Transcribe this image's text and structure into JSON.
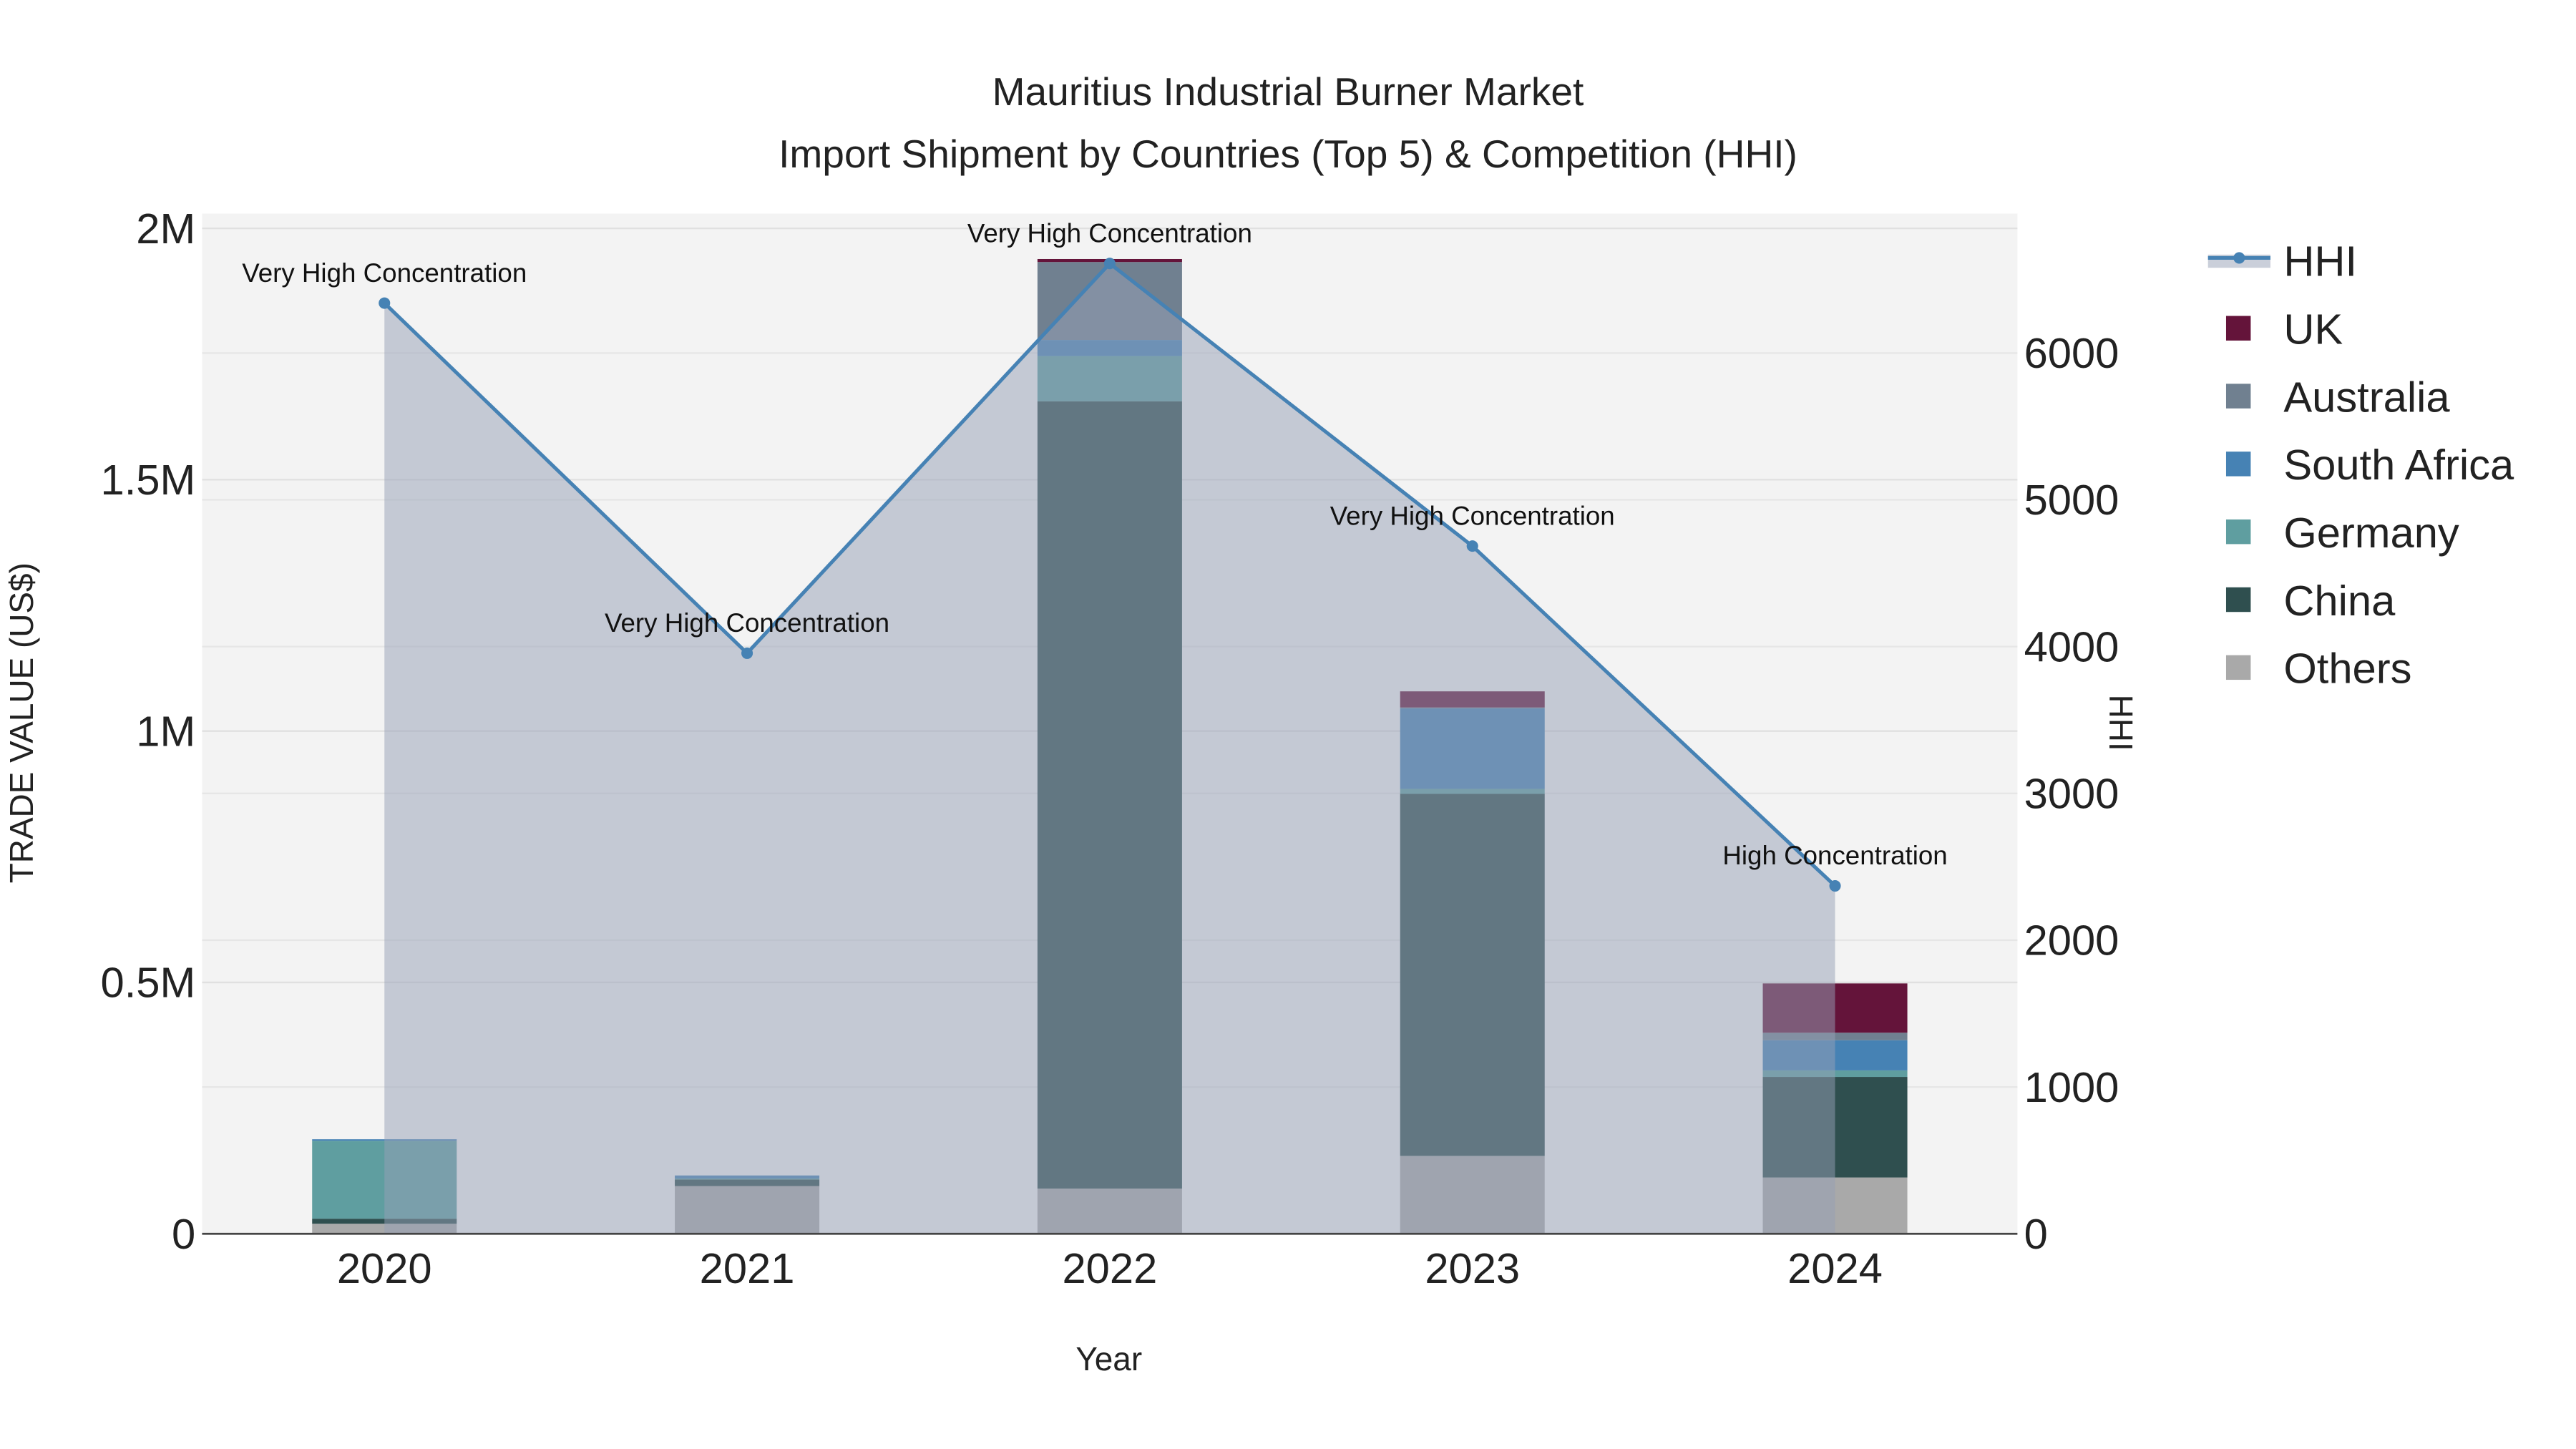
{
  "chart_data": {
    "type": "bar",
    "title_line1": "Mauritius Industrial Burner Market",
    "title_line2": "Import Shipment by Countries (Top 5) & Competition (HHI)",
    "xlabel": "Year",
    "ylabel": "TRADE VALUE (US$)",
    "y2label": "HHI",
    "categories": [
      "2020",
      "2021",
      "2022",
      "2023",
      "2024"
    ],
    "ylim": [
      0,
      2000000
    ],
    "y_ticks": [
      {
        "v": 0,
        "label": "0"
      },
      {
        "v": 500000,
        "label": "0.5M"
      },
      {
        "v": 1000000,
        "label": "1M"
      },
      {
        "v": 1500000,
        "label": "1.5M"
      },
      {
        "v": 2000000,
        "label": "2M"
      }
    ],
    "y2lim": [
      0,
      6950
    ],
    "y2_ticks": [
      0,
      1000,
      2000,
      3000,
      4000,
      5000,
      6000
    ],
    "series": [
      {
        "name": "Others",
        "color": "#a9a9a9",
        "values": [
          20000,
          95000,
          90000,
          155000,
          112000
        ]
      },
      {
        "name": "China",
        "color": "#2f4f4f",
        "values": [
          10000,
          13000,
          1566000,
          720000,
          200000
        ]
      },
      {
        "name": "Germany",
        "color": "#5f9ea0",
        "values": [
          155000,
          2000,
          90000,
          10000,
          13000
        ]
      },
      {
        "name": "South Africa",
        "color": "#4682b4",
        "values": [
          3000,
          6000,
          32000,
          160000,
          60000
        ]
      },
      {
        "name": "Australia",
        "color": "#708090",
        "values": [
          0,
          0,
          155000,
          2000,
          15000
        ]
      },
      {
        "name": "UK",
        "color": "#64143a",
        "values": [
          0,
          0,
          6000,
          32000,
          98000
        ]
      }
    ],
    "hhi": {
      "name": "HHI",
      "color": "#4682b4",
      "values": [
        6340,
        3955,
        6610,
        4685,
        2370
      ],
      "annotations": [
        "Very High Concentration",
        "Very High Concentration",
        "Very High Concentration",
        "Very High Concentration",
        "High Concentration"
      ]
    },
    "legend": [
      "HHI",
      "UK",
      "Australia",
      "South Africa",
      "Germany",
      "China",
      "Others"
    ],
    "legend_placement": "right"
  }
}
